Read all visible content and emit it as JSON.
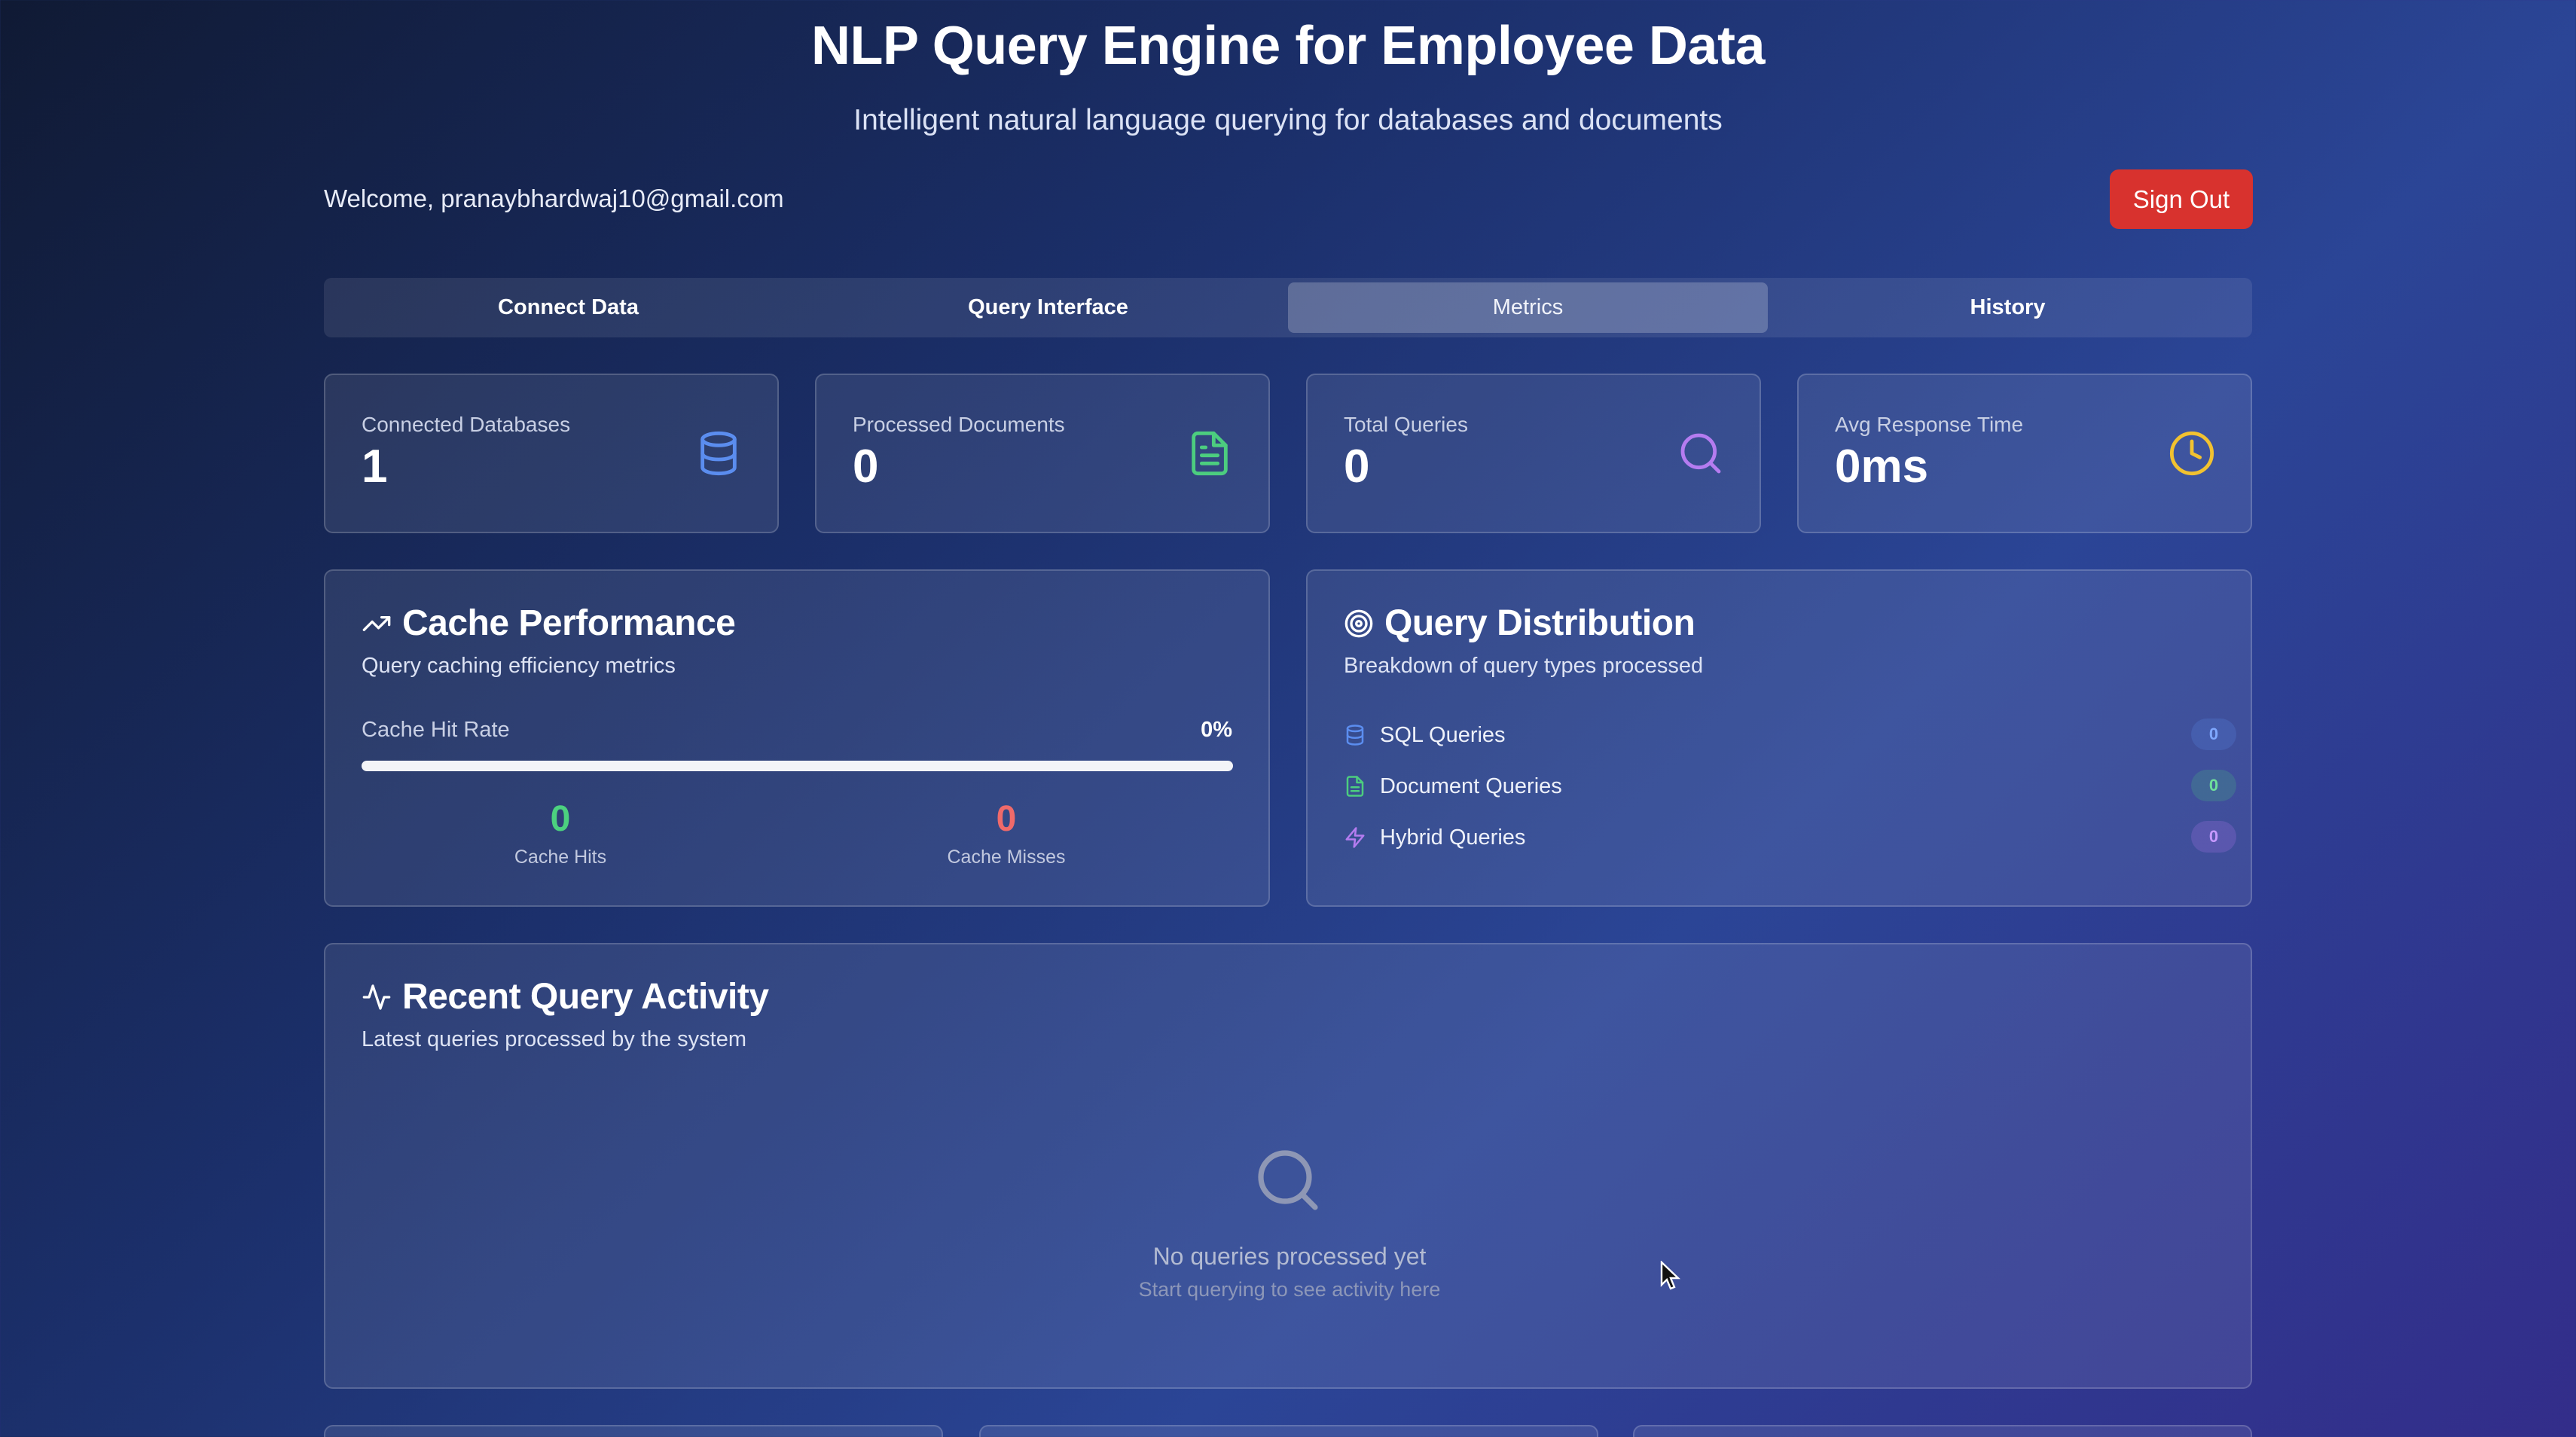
{
  "header": {
    "title": "NLP Query Engine for Employee Data",
    "subtitle": "Intelligent natural language querying for databases and documents",
    "welcome": "Welcome, pranaybhardwaj10@gmail.com",
    "sign_out_label": "Sign Out"
  },
  "tabs": [
    {
      "label": "Connect Data",
      "active": false
    },
    {
      "label": "Query Interface",
      "active": false
    },
    {
      "label": "Metrics",
      "active": true
    },
    {
      "label": "History",
      "active": false
    }
  ],
  "stats": [
    {
      "label": "Connected Databases",
      "value": "1",
      "icon": "database-icon",
      "color": "#5b8def"
    },
    {
      "label": "Processed Documents",
      "value": "0",
      "icon": "document-icon",
      "color": "#4ccd7f"
    },
    {
      "label": "Total Queries",
      "value": "0",
      "icon": "search-icon",
      "color": "#b57cf0"
    },
    {
      "label": "Avg Response Time",
      "value": "0ms",
      "icon": "clock-icon",
      "color": "#f2c230"
    }
  ],
  "cache": {
    "title": "Cache Performance",
    "description": "Query caching efficiency metrics",
    "hit_rate_label": "Cache Hit Rate",
    "hit_rate_value": "0%",
    "hit_rate_fraction": 0,
    "hits_value": "0",
    "hits_label": "Cache Hits",
    "misses_value": "0",
    "misses_label": "Cache Misses",
    "hits_color": "#4cd27f",
    "misses_color": "#ef6a6a"
  },
  "distribution": {
    "title": "Query Distribution",
    "description": "Breakdown of query types processed",
    "items": [
      {
        "label": "SQL Queries",
        "count": "0",
        "icon": "database-icon",
        "color": "#5b8def"
      },
      {
        "label": "Document Queries",
        "count": "0",
        "icon": "document-icon",
        "color": "#4ccd7f"
      },
      {
        "label": "Hybrid Queries",
        "count": "0",
        "icon": "lightning-icon",
        "color": "#b57cf0"
      }
    ]
  },
  "activity": {
    "title": "Recent Query Activity",
    "description": "Latest queries processed by the system",
    "empty_title": "No queries processed yet",
    "empty_subtitle": "Start querying to see activity here"
  }
}
